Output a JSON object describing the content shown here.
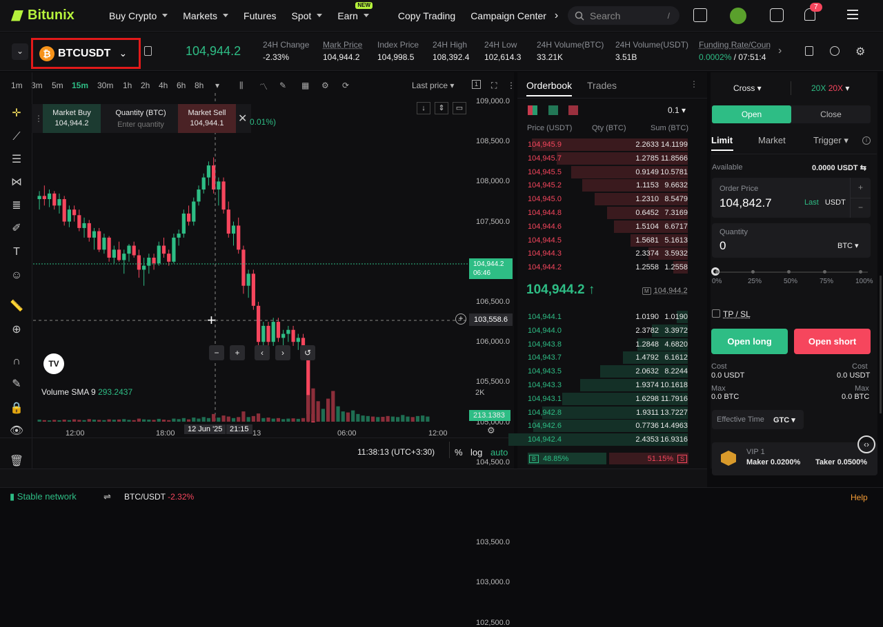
{
  "nav": {
    "brand": "Bitunix",
    "items": [
      "Buy Crypto",
      "Markets",
      "Futures",
      "Spot",
      "Earn",
      "Copy Trading",
      "Campaign Center"
    ],
    "earn_badge": "NEW",
    "search_placeholder": "Search",
    "search_shortcut": "/",
    "notif_count": "7"
  },
  "symbol": {
    "name": "BTCUSDT",
    "coin_glyph": "₿",
    "last_price": "104,944.2",
    "stats": [
      {
        "label": "24H Change",
        "value": "-2.33%"
      },
      {
        "label": "Mark Price",
        "value": "104,944.2"
      },
      {
        "label": "Index Price",
        "value": "104,998.5"
      },
      {
        "label": "24H High",
        "value": "108,392.4"
      },
      {
        "label": "24H Low",
        "value": "102,614.3"
      },
      {
        "label": "24H Volume(BTC)",
        "value": "33.21K"
      },
      {
        "label": "24H Volume(USDT)",
        "value": "3.51B"
      },
      {
        "label": "Funding Rate/Coun",
        "value": "0.0002%",
        "value2": "/ 07:51:4"
      }
    ]
  },
  "chart": {
    "timeframes": [
      "1m",
      "3m",
      "5m",
      "15m",
      "30m",
      "1h",
      "2h",
      "4h",
      "6h",
      "8h"
    ],
    "active_tf": "15m",
    "price_type": "Last price",
    "quick_trade": {
      "buy_label": "Market Buy",
      "buy_price": "104,944.2",
      "qty_label": "Quantity (BTC)",
      "qty_placeholder": "Enter quantity",
      "sell_label": "Market Sell",
      "sell_price": "104,944.1",
      "change": "0.01%)"
    },
    "price_axis": [
      "109,000.0",
      "108,500.0",
      "108,000.0",
      "107,500.0",
      "107,000.0",
      "106,500.0",
      "106,000.0",
      "105,500.0",
      "105,000.0",
      "104,500.0",
      "104,000.0",
      "103,500.0",
      "103,000.0",
      "102,500.0"
    ],
    "last_price_tag": "104,944.2",
    "last_price_timer": "06:46",
    "crosshair_tag": "103,558.6",
    "time_axis": [
      "12:00",
      "18:00",
      "12 Jun '25",
      "21:15",
      "13",
      "06:00",
      "12:00"
    ],
    "volume_label": "Volume SMA 9",
    "volume_value": "293.2437",
    "volume_axis": "2K",
    "volume_tag": "213.1383",
    "clock": "11:38:13 (UTC+3:30)",
    "scale_opts": [
      "%",
      "log",
      "auto"
    ],
    "tv_logo": "TV"
  },
  "orderbook": {
    "tabs": [
      "Orderbook",
      "Trades"
    ],
    "precision": "0.1",
    "headers": [
      "Price (USDT)",
      "Qty (BTC)",
      "Sum (BTC)"
    ],
    "asks": [
      {
        "p": "104,945.9",
        "q": "2.2633",
        "s": "14.1199",
        "d": 0.87
      },
      {
        "p": "104,945.7",
        "q": "1.2785",
        "s": "11.8566",
        "d": 0.73
      },
      {
        "p": "104,945.5",
        "q": "0.9149",
        "s": "10.5781",
        "d": 0.65
      },
      {
        "p": "104,945.2",
        "q": "1.1153",
        "s": "9.6632",
        "d": 0.59
      },
      {
        "p": "104,945.0",
        "q": "1.2310",
        "s": "8.5479",
        "d": 0.52
      },
      {
        "p": "104,944.8",
        "q": "0.6452",
        "s": "7.3169",
        "d": 0.45
      },
      {
        "p": "104,944.6",
        "q": "1.5104",
        "s": "6.6717",
        "d": 0.41
      },
      {
        "p": "104,944.5",
        "q": "1.5681",
        "s": "5.1613",
        "d": 0.32
      },
      {
        "p": "104,944.3",
        "q": "2.3374",
        "s": "3.5932",
        "d": 0.22
      },
      {
        "p": "104,944.2",
        "q": "1.2558",
        "s": "1.2558",
        "d": 0.08
      }
    ],
    "mid_price": "104,944.2",
    "mid_arrow": "↑",
    "mark_price": "104,944.2",
    "bids": [
      {
        "p": "104,944.1",
        "q": "1.0190",
        "s": "1.0190",
        "d": 0.06
      },
      {
        "p": "104,944.0",
        "q": "2.3782",
        "s": "3.3972",
        "d": 0.2
      },
      {
        "p": "104,943.8",
        "q": "1.2848",
        "s": "4.6820",
        "d": 0.28
      },
      {
        "p": "104,943.7",
        "q": "1.4792",
        "s": "6.1612",
        "d": 0.36
      },
      {
        "p": "104,943.5",
        "q": "2.0632",
        "s": "8.2244",
        "d": 0.49
      },
      {
        "p": "104,943.3",
        "q": "1.9374",
        "s": "10.1618",
        "d": 0.6
      },
      {
        "p": "104,943.1",
        "q": "1.6298",
        "s": "11.7916",
        "d": 0.7
      },
      {
        "p": "104,942.8",
        "q": "1.9311",
        "s": "13.7227",
        "d": 0.81
      },
      {
        "p": "104,942.6",
        "q": "0.7736",
        "s": "14.4963",
        "d": 0.86
      },
      {
        "p": "104,942.4",
        "q": "2.4353",
        "s": "16.9316",
        "d": 1.0
      }
    ],
    "buy_label": "B",
    "buy_pct": "48.85%",
    "sell_pct": "51.15%",
    "sell_label": "S",
    "buy_ratio": 0.4885
  },
  "trade": {
    "margin_mode": "Cross",
    "lev_long": "20X",
    "lev_short": "20X",
    "tabs": [
      "Open",
      "Close"
    ],
    "order_types": [
      "Limit",
      "Market",
      "Trigger"
    ],
    "available_label": "Available",
    "available_value": "0.0000 USDT",
    "order_price_label": "Order Price",
    "order_price": "104,842.7",
    "last_label": "Last",
    "unit": "USDT",
    "quantity_label": "Quantity",
    "quantity": "0",
    "qty_unit": "BTC",
    "slider_marks": [
      "0%",
      "25%",
      "50%",
      "75%",
      "100%"
    ],
    "slider_fraction": 0,
    "tpsl": "TP / SL",
    "open_long": "Open long",
    "open_short": "Open short",
    "cost_label": "Cost",
    "cost_long": "0.0 USDT",
    "cost_short": "0.0 USDT",
    "max_label": "Max",
    "max_long": "0.0 BTC",
    "max_short": "0.0 BTC",
    "effective_time_label": "Effective Time",
    "effective_time": "GTC",
    "vip": "VIP 1",
    "maker": "Maker 0.0200%",
    "taker": "Taker 0.0500%"
  },
  "bottom": {
    "network": "Stable network",
    "ticker": "BTC/USDT",
    "ticker_change": "-2.32%",
    "help": "Help"
  },
  "colors": {
    "up": "#2ebd85",
    "down": "#f6465d",
    "brand": "#b6f23c",
    "highlight": "#e21a1a"
  },
  "chart_data": {
    "type": "candlestick",
    "ylim": [
      102300,
      109200
    ],
    "note_series": "15m candles, approximate",
    "candles": [
      [
        107780,
        107880,
        107650,
        107820
      ],
      [
        107820,
        107950,
        107700,
        107780
      ],
      [
        107780,
        107900,
        107680,
        107850
      ],
      [
        107850,
        107880,
        107650,
        107700
      ],
      [
        107700,
        107850,
        107600,
        107780
      ],
      [
        107780,
        107820,
        107450,
        107500
      ],
      [
        107500,
        107700,
        107430,
        107650
      ],
      [
        107650,
        107700,
        107500,
        107580
      ],
      [
        107580,
        107650,
        107380,
        107420
      ],
      [
        107420,
        107550,
        107300,
        107480
      ],
      [
        107480,
        107520,
        107250,
        107300
      ],
      [
        107300,
        107420,
        107150,
        107380
      ],
      [
        107380,
        107420,
        107120,
        107150
      ],
      [
        107150,
        107350,
        107100,
        107300
      ],
      [
        107300,
        107320,
        107000,
        107050
      ],
      [
        107050,
        107200,
        106980,
        107150
      ],
      [
        107150,
        107250,
        107000,
        107020
      ],
      [
        107020,
        107150,
        106850,
        107100
      ],
      [
        107100,
        107220,
        107000,
        107200
      ],
      [
        107200,
        107250,
        107050,
        107080
      ],
      [
        107080,
        107150,
        106800,
        106900
      ],
      [
        106900,
        107050,
        106700,
        106950
      ],
      [
        106950,
        107100,
        106850,
        107050
      ],
      [
        107050,
        107100,
        106900,
        106980
      ],
      [
        106980,
        107250,
        106950,
        107200
      ],
      [
        107200,
        107300,
        107050,
        107100
      ],
      [
        107100,
        107150,
        106950,
        107000
      ],
      [
        107000,
        107350,
        106980,
        107300
      ],
      [
        107300,
        107400,
        107200,
        107350
      ],
      [
        107350,
        107650,
        107300,
        107600
      ],
      [
        107600,
        107700,
        107450,
        107500
      ],
      [
        107500,
        107800,
        107450,
        107750
      ],
      [
        107750,
        107950,
        107700,
        107900
      ],
      [
        107900,
        108100,
        107850,
        108050
      ],
      [
        108050,
        108250,
        107950,
        108200
      ],
      [
        108200,
        108300,
        107850,
        107900
      ],
      [
        107900,
        108050,
        107700,
        108000
      ],
      [
        108000,
        108050,
        107600,
        107650
      ],
      [
        107650,
        107750,
        107300,
        107350
      ],
      [
        107350,
        107500,
        107200,
        107450
      ],
      [
        107450,
        107550,
        107100,
        107150
      ],
      [
        107150,
        107200,
        106600,
        106700
      ],
      [
        106700,
        106900,
        106550,
        106850
      ],
      [
        106850,
        106900,
        106400,
        106450
      ],
      [
        106450,
        106500,
        105950,
        106000
      ],
      [
        106000,
        106250,
        105900,
        106200
      ],
      [
        106200,
        106250,
        105950,
        106000
      ],
      [
        106000,
        106300,
        105950,
        106250
      ],
      [
        106250,
        106300,
        106000,
        106050
      ],
      [
        106050,
        106150,
        105950,
        106100
      ],
      [
        106100,
        106200,
        106000,
        106150
      ],
      [
        106150,
        106200,
        105950,
        106000
      ],
      [
        106000,
        106100,
        105900,
        106050
      ],
      [
        106050,
        106100,
        105850,
        105950
      ],
      [
        105950,
        105650,
        105000,
        105100
      ],
      [
        105100,
        105150,
        104150,
        104250
      ],
      [
        104250,
        104300,
        103650,
        103800
      ],
      [
        103800,
        104100,
        103650,
        104000
      ],
      [
        104000,
        104050,
        103300,
        103400
      ],
      [
        103400,
        103600,
        102800,
        102900
      ],
      [
        102900,
        103300,
        102750,
        103200
      ],
      [
        103200,
        103600,
        103150,
        103500
      ],
      [
        103500,
        103700,
        103250,
        103300
      ],
      [
        103300,
        103800,
        103250,
        103750
      ],
      [
        103750,
        103950,
        103600,
        103900
      ],
      [
        103900,
        104100,
        103800,
        104050
      ],
      [
        104050,
        104200,
        103900,
        104150
      ],
      [
        104150,
        104250,
        103950,
        104000
      ],
      [
        104000,
        104150,
        103900,
        104100
      ],
      [
        104100,
        104200,
        103950,
        104000
      ],
      [
        104000,
        104050,
        103800,
        103850
      ],
      [
        103850,
        104000,
        103750,
        103950
      ],
      [
        103950,
        104100,
        103850,
        104050
      ],
      [
        104050,
        104400,
        104000,
        104350
      ],
      [
        104350,
        104600,
        104300,
        104550
      ],
      [
        104550,
        104600,
        104300,
        104400
      ],
      [
        104400,
        104700,
        104350,
        104650
      ],
      [
        104650,
        104900,
        104600,
        104850
      ],
      [
        104850,
        104950,
        104700,
        104944
      ]
    ],
    "volume": [
      40,
      30,
      25,
      35,
      28,
      40,
      30,
      45,
      35,
      30,
      50,
      40,
      35,
      30,
      45,
      38,
      42,
      50,
      35,
      30,
      60,
      45,
      40,
      35,
      55,
      40,
      30,
      60,
      50,
      70,
      45,
      80,
      60,
      90,
      70,
      150,
      80,
      120,
      100,
      70,
      90,
      200,
      90,
      110,
      160,
      70,
      80,
      60,
      70,
      50,
      60,
      65,
      55,
      70,
      520,
      650,
      400,
      250,
      450,
      600,
      300,
      200,
      180,
      220,
      150,
      120,
      110,
      100,
      90,
      95,
      110,
      100,
      90,
      130,
      100,
      90,
      110,
      120,
      100
    ]
  }
}
